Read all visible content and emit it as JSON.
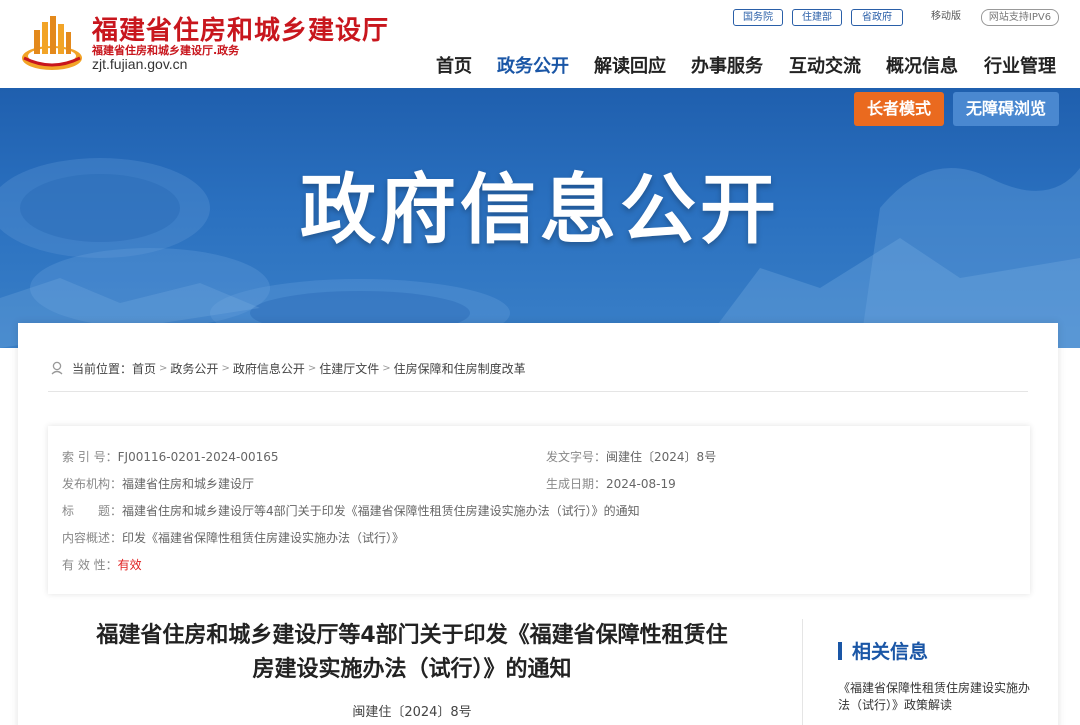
{
  "header": {
    "site_name": "福建省住房和城乡建设厅",
    "site_sub": "福建省住房和城乡建设厅.政务",
    "site_url": "zjt.fujian.gov.cn",
    "top_links": [
      "国务院",
      "住建部",
      "省政府"
    ],
    "mobile": "移动版",
    "ipv6": "网站支持IPV6"
  },
  "nav": {
    "items": [
      "首页",
      "政务公开",
      "解读回应",
      "办事服务",
      "互动交流",
      "概况信息",
      "行业管理"
    ],
    "active": "政务公开"
  },
  "banner": {
    "title": "政府信息公开",
    "elder_mode": "长者模式",
    "accessible": "无障碍浏览"
  },
  "breadcrumb": {
    "prefix": "当前位置：",
    "items": [
      "首页",
      "政务公开",
      "政府信息公开",
      "住建厅文件",
      "住房保障和住房制度改革"
    ]
  },
  "meta": {
    "index_label": "索 引 号：",
    "index_value": "FJ00116-0201-2024-00165",
    "docno_label": "发文字号：",
    "docno_value": "闽建住〔2024〕8号",
    "publisher_label": "发布机构：",
    "publisher_value": "福建省住房和城乡建设厅",
    "date_label": "生成日期：",
    "date_value": "2024-08-19",
    "title_label": "标　　题：",
    "title_value": "福建省住房和城乡建设厅等4部门关于印发《福建省保障性租赁住房建设实施办法（试行）》的通知",
    "summary_label": "内容概述：",
    "summary_value": "印发《福建省保障性租赁住房建设实施办法（试行）》",
    "validity_label": "有 效 性：",
    "validity_value": "有效"
  },
  "document": {
    "title_line1": "福建省住房和城乡建设厅等4部门关于印发《福建省保障性租赁住",
    "title_line2": "房建设实施办法（试行）》的通知",
    "doc_no": "闽建住〔2024〕8号"
  },
  "related": {
    "heading": "相关信息",
    "link": "《福建省保障性租赁住房建设实施办法（试行）》政策解读"
  },
  "colors": {
    "brand_red": "#c8161d",
    "accent_blue": "#1a56a6",
    "elder_orange": "#ea6a1f",
    "valid_red": "#e02020"
  }
}
